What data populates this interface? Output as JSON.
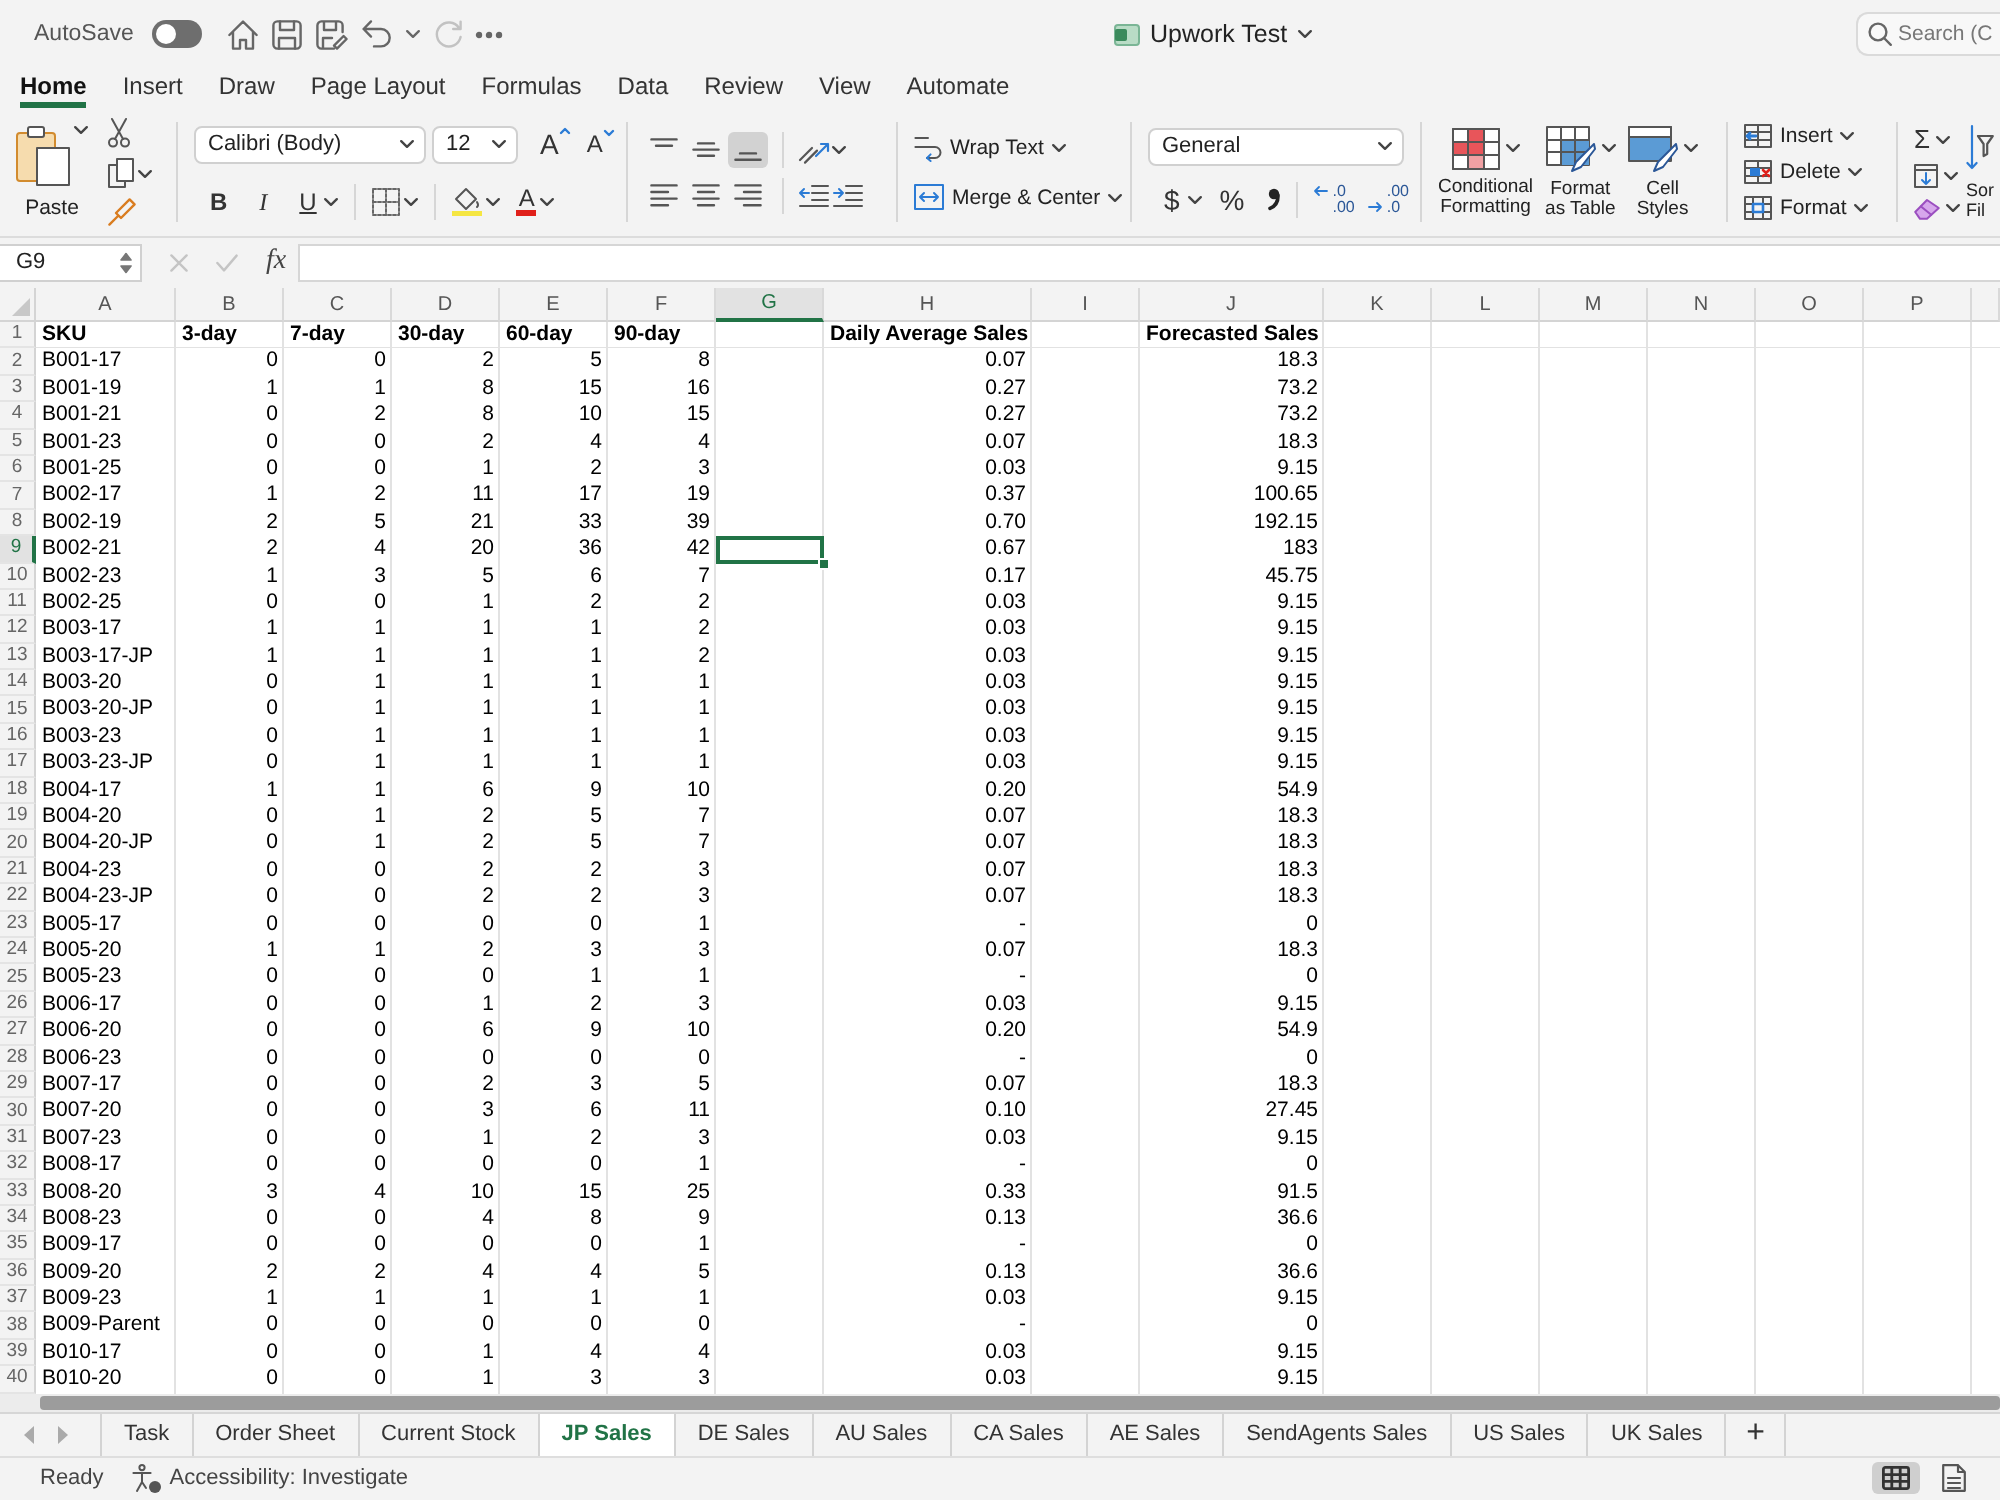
{
  "title_bar": {
    "autosave": {
      "label": "AutoSave",
      "on": false
    },
    "quick_access": [
      {
        "kind": "home",
        "disabled": false
      },
      {
        "kind": "save",
        "disabled": false
      },
      {
        "kind": "save_as",
        "disabled": false
      },
      {
        "kind": "undo",
        "disabled": false
      },
      {
        "kind": "redo",
        "disabled": true
      },
      {
        "kind": "more",
        "disabled": false
      }
    ],
    "document_title": "Upwork Test",
    "search": {
      "placeholder": "Search (C"
    }
  },
  "ribbon_tabs": [
    {
      "label": "Home",
      "selected": true
    },
    {
      "label": "Insert",
      "selected": false
    },
    {
      "label": "Draw",
      "selected": false
    },
    {
      "label": "Page Layout",
      "selected": false
    },
    {
      "label": "Formulas",
      "selected": false
    },
    {
      "label": "Data",
      "selected": false
    },
    {
      "label": "Review",
      "selected": false
    },
    {
      "label": "View",
      "selected": false
    },
    {
      "label": "Automate",
      "selected": false
    }
  ],
  "ribbon": {
    "clipboard": {
      "paste_label": "Paste"
    },
    "font": {
      "name": "Calibri (Body)",
      "size": "12",
      "grow_label": "A",
      "shrink_label": "A",
      "bold_label": "B",
      "italic_label": "I",
      "underline_label": "U",
      "font_color_label": "A"
    },
    "alignment": {
      "vertical": [
        {
          "kind": "top",
          "selected": false
        },
        {
          "kind": "middle",
          "selected": false
        },
        {
          "kind": "bottom",
          "selected": true
        }
      ],
      "horizontal": [
        {
          "kind": "left",
          "selected": false
        },
        {
          "kind": "center",
          "selected": false
        },
        {
          "kind": "right",
          "selected": false
        }
      ],
      "wrap_text_label": "Wrap Text",
      "merge_label": "Merge & Center"
    },
    "number": {
      "format": "General",
      "currency_label": "$",
      "percent_label": "%",
      "decimals": [
        {
          "kind": "increase",
          "lines": [
            ".0",
            ".00"
          ]
        },
        {
          "kind": "decrease",
          "lines": [
            ".00",
            ".0"
          ]
        }
      ]
    },
    "styles": [
      {
        "kind": "conditional",
        "label_lines": [
          "Conditional",
          "Formatting"
        ]
      },
      {
        "kind": "table",
        "label_lines": [
          "Format",
          "as Table"
        ]
      },
      {
        "kind": "cell",
        "label_lines": [
          "Cell",
          "Styles"
        ]
      }
    ],
    "cells": [
      {
        "kind": "insert",
        "label": "Insert"
      },
      {
        "kind": "delete",
        "label": "Delete"
      },
      {
        "kind": "format",
        "label": "Format"
      }
    ],
    "editing": {
      "autosum_label": "Σ",
      "sort_label_lines": [
        "Sor",
        "Fil"
      ]
    }
  },
  "formula_bar": {
    "name_box": "G9",
    "cancel_disabled": true,
    "enter_disabled": true,
    "function_label": "fx"
  },
  "sheet": {
    "columns": [
      {
        "label": "A",
        "selected": false
      },
      {
        "label": "B",
        "selected": false
      },
      {
        "label": "C",
        "selected": false
      },
      {
        "label": "D",
        "selected": false
      },
      {
        "label": "E",
        "selected": false
      },
      {
        "label": "F",
        "selected": false
      },
      {
        "label": "G",
        "selected": true
      },
      {
        "label": "H",
        "selected": false
      },
      {
        "label": "I",
        "selected": false
      },
      {
        "label": "J",
        "selected": false
      },
      {
        "label": "K",
        "selected": false
      },
      {
        "label": "L",
        "selected": false
      },
      {
        "label": "M",
        "selected": false
      },
      {
        "label": "N",
        "selected": false
      },
      {
        "label": "O",
        "selected": false
      },
      {
        "label": "P",
        "selected": false
      }
    ],
    "header_row": {
      "number": "1",
      "selected": false,
      "sku": "SKU",
      "3_day": "3-day",
      "7_day": "7-day",
      "30_day": "30-day",
      "60_day": "60-day",
      "90_day": "90-day",
      "daily_average_sales": "Daily Average Sales",
      "forecasted_sales": "Forecasted Sales"
    },
    "rows": [
      {
        "number": "2",
        "selected": false,
        "sku": "B001-17",
        "3_day": "0",
        "7_day": "0",
        "30_day": "2",
        "60_day": "5",
        "90_day": "8",
        "daily_average_sales": "0.07",
        "forecasted_sales": "18.3"
      },
      {
        "number": "3",
        "selected": false,
        "sku": "B001-19",
        "3_day": "1",
        "7_day": "1",
        "30_day": "8",
        "60_day": "15",
        "90_day": "16",
        "daily_average_sales": "0.27",
        "forecasted_sales": "73.2"
      },
      {
        "number": "4",
        "selected": false,
        "sku": "B001-21",
        "3_day": "0",
        "7_day": "2",
        "30_day": "8",
        "60_day": "10",
        "90_day": "15",
        "daily_average_sales": "0.27",
        "forecasted_sales": "73.2"
      },
      {
        "number": "5",
        "selected": false,
        "sku": "B001-23",
        "3_day": "0",
        "7_day": "0",
        "30_day": "2",
        "60_day": "4",
        "90_day": "4",
        "daily_average_sales": "0.07",
        "forecasted_sales": "18.3"
      },
      {
        "number": "6",
        "selected": false,
        "sku": "B001-25",
        "3_day": "0",
        "7_day": "0",
        "30_day": "1",
        "60_day": "2",
        "90_day": "3",
        "daily_average_sales": "0.03",
        "forecasted_sales": "9.15"
      },
      {
        "number": "7",
        "selected": false,
        "sku": "B002-17",
        "3_day": "1",
        "7_day": "2",
        "30_day": "11",
        "60_day": "17",
        "90_day": "19",
        "daily_average_sales": "0.37",
        "forecasted_sales": "100.65"
      },
      {
        "number": "8",
        "selected": false,
        "sku": "B002-19",
        "3_day": "2",
        "7_day": "5",
        "30_day": "21",
        "60_day": "33",
        "90_day": "39",
        "daily_average_sales": "0.70",
        "forecasted_sales": "192.15"
      },
      {
        "number": "9",
        "selected": true,
        "sku": "B002-21",
        "3_day": "2",
        "7_day": "4",
        "30_day": "20",
        "60_day": "36",
        "90_day": "42",
        "daily_average_sales": "0.67",
        "forecasted_sales": "183"
      },
      {
        "number": "10",
        "selected": false,
        "sku": "B002-23",
        "3_day": "1",
        "7_day": "3",
        "30_day": "5",
        "60_day": "6",
        "90_day": "7",
        "daily_average_sales": "0.17",
        "forecasted_sales": "45.75"
      },
      {
        "number": "11",
        "selected": false,
        "sku": "B002-25",
        "3_day": "0",
        "7_day": "0",
        "30_day": "1",
        "60_day": "2",
        "90_day": "2",
        "daily_average_sales": "0.03",
        "forecasted_sales": "9.15"
      },
      {
        "number": "12",
        "selected": false,
        "sku": "B003-17",
        "3_day": "1",
        "7_day": "1",
        "30_day": "1",
        "60_day": "1",
        "90_day": "2",
        "daily_average_sales": "0.03",
        "forecasted_sales": "9.15"
      },
      {
        "number": "13",
        "selected": false,
        "sku": "B003-17-JP",
        "3_day": "1",
        "7_day": "1",
        "30_day": "1",
        "60_day": "1",
        "90_day": "2",
        "daily_average_sales": "0.03",
        "forecasted_sales": "9.15"
      },
      {
        "number": "14",
        "selected": false,
        "sku": "B003-20",
        "3_day": "0",
        "7_day": "1",
        "30_day": "1",
        "60_day": "1",
        "90_day": "1",
        "daily_average_sales": "0.03",
        "forecasted_sales": "9.15"
      },
      {
        "number": "15",
        "selected": false,
        "sku": "B003-20-JP",
        "3_day": "0",
        "7_day": "1",
        "30_day": "1",
        "60_day": "1",
        "90_day": "1",
        "daily_average_sales": "0.03",
        "forecasted_sales": "9.15"
      },
      {
        "number": "16",
        "selected": false,
        "sku": "B003-23",
        "3_day": "0",
        "7_day": "1",
        "30_day": "1",
        "60_day": "1",
        "90_day": "1",
        "daily_average_sales": "0.03",
        "forecasted_sales": "9.15"
      },
      {
        "number": "17",
        "selected": false,
        "sku": "B003-23-JP",
        "3_day": "0",
        "7_day": "1",
        "30_day": "1",
        "60_day": "1",
        "90_day": "1",
        "daily_average_sales": "0.03",
        "forecasted_sales": "9.15"
      },
      {
        "number": "18",
        "selected": false,
        "sku": "B004-17",
        "3_day": "1",
        "7_day": "1",
        "30_day": "6",
        "60_day": "9",
        "90_day": "10",
        "daily_average_sales": "0.20",
        "forecasted_sales": "54.9"
      },
      {
        "number": "19",
        "selected": false,
        "sku": "B004-20",
        "3_day": "0",
        "7_day": "1",
        "30_day": "2",
        "60_day": "5",
        "90_day": "7",
        "daily_average_sales": "0.07",
        "forecasted_sales": "18.3"
      },
      {
        "number": "20",
        "selected": false,
        "sku": "B004-20-JP",
        "3_day": "0",
        "7_day": "1",
        "30_day": "2",
        "60_day": "5",
        "90_day": "7",
        "daily_average_sales": "0.07",
        "forecasted_sales": "18.3"
      },
      {
        "number": "21",
        "selected": false,
        "sku": "B004-23",
        "3_day": "0",
        "7_day": "0",
        "30_day": "2",
        "60_day": "2",
        "90_day": "3",
        "daily_average_sales": "0.07",
        "forecasted_sales": "18.3"
      },
      {
        "number": "22",
        "selected": false,
        "sku": "B004-23-JP",
        "3_day": "0",
        "7_day": "0",
        "30_day": "2",
        "60_day": "2",
        "90_day": "3",
        "daily_average_sales": "0.07",
        "forecasted_sales": "18.3"
      },
      {
        "number": "23",
        "selected": false,
        "sku": "B005-17",
        "3_day": "0",
        "7_day": "0",
        "30_day": "0",
        "60_day": "0",
        "90_day": "1",
        "daily_average_sales": "-",
        "forecasted_sales": "0"
      },
      {
        "number": "24",
        "selected": false,
        "sku": "B005-20",
        "3_day": "1",
        "7_day": "1",
        "30_day": "2",
        "60_day": "3",
        "90_day": "3",
        "daily_average_sales": "0.07",
        "forecasted_sales": "18.3"
      },
      {
        "number": "25",
        "selected": false,
        "sku": "B005-23",
        "3_day": "0",
        "7_day": "0",
        "30_day": "0",
        "60_day": "1",
        "90_day": "1",
        "daily_average_sales": "-",
        "forecasted_sales": "0"
      },
      {
        "number": "26",
        "selected": false,
        "sku": "B006-17",
        "3_day": "0",
        "7_day": "0",
        "30_day": "1",
        "60_day": "2",
        "90_day": "3",
        "daily_average_sales": "0.03",
        "forecasted_sales": "9.15"
      },
      {
        "number": "27",
        "selected": false,
        "sku": "B006-20",
        "3_day": "0",
        "7_day": "0",
        "30_day": "6",
        "60_day": "9",
        "90_day": "10",
        "daily_average_sales": "0.20",
        "forecasted_sales": "54.9"
      },
      {
        "number": "28",
        "selected": false,
        "sku": "B006-23",
        "3_day": "0",
        "7_day": "0",
        "30_day": "0",
        "60_day": "0",
        "90_day": "0",
        "daily_average_sales": "-",
        "forecasted_sales": "0"
      },
      {
        "number": "29",
        "selected": false,
        "sku": "B007-17",
        "3_day": "0",
        "7_day": "0",
        "30_day": "2",
        "60_day": "3",
        "90_day": "5",
        "daily_average_sales": "0.07",
        "forecasted_sales": "18.3"
      },
      {
        "number": "30",
        "selected": false,
        "sku": "B007-20",
        "3_day": "0",
        "7_day": "0",
        "30_day": "3",
        "60_day": "6",
        "90_day": "11",
        "daily_average_sales": "0.10",
        "forecasted_sales": "27.45"
      },
      {
        "number": "31",
        "selected": false,
        "sku": "B007-23",
        "3_day": "0",
        "7_day": "0",
        "30_day": "1",
        "60_day": "2",
        "90_day": "3",
        "daily_average_sales": "0.03",
        "forecasted_sales": "9.15"
      },
      {
        "number": "32",
        "selected": false,
        "sku": "B008-17",
        "3_day": "0",
        "7_day": "0",
        "30_day": "0",
        "60_day": "0",
        "90_day": "1",
        "daily_average_sales": "-",
        "forecasted_sales": "0"
      },
      {
        "number": "33",
        "selected": false,
        "sku": "B008-20",
        "3_day": "3",
        "7_day": "4",
        "30_day": "10",
        "60_day": "15",
        "90_day": "25",
        "daily_average_sales": "0.33",
        "forecasted_sales": "91.5"
      },
      {
        "number": "34",
        "selected": false,
        "sku": "B008-23",
        "3_day": "0",
        "7_day": "0",
        "30_day": "4",
        "60_day": "8",
        "90_day": "9",
        "daily_average_sales": "0.13",
        "forecasted_sales": "36.6"
      },
      {
        "number": "35",
        "selected": false,
        "sku": "B009-17",
        "3_day": "0",
        "7_day": "0",
        "30_day": "0",
        "60_day": "0",
        "90_day": "1",
        "daily_average_sales": "-",
        "forecasted_sales": "0"
      },
      {
        "number": "36",
        "selected": false,
        "sku": "B009-20",
        "3_day": "2",
        "7_day": "2",
        "30_day": "4",
        "60_day": "4",
        "90_day": "5",
        "daily_average_sales": "0.13",
        "forecasted_sales": "36.6"
      },
      {
        "number": "37",
        "selected": false,
        "sku": "B009-23",
        "3_day": "1",
        "7_day": "1",
        "30_day": "1",
        "60_day": "1",
        "90_day": "1",
        "daily_average_sales": "0.03",
        "forecasted_sales": "9.15"
      },
      {
        "number": "38",
        "selected": false,
        "sku": "B009-Parent",
        "3_day": "0",
        "7_day": "0",
        "30_day": "0",
        "60_day": "0",
        "90_day": "0",
        "daily_average_sales": "-",
        "forecasted_sales": "0"
      },
      {
        "number": "39",
        "selected": false,
        "sku": "B010-17",
        "3_day": "0",
        "7_day": "0",
        "30_day": "1",
        "60_day": "4",
        "90_day": "4",
        "daily_average_sales": "0.03",
        "forecasted_sales": "9.15"
      },
      {
        "number": "40",
        "selected": false,
        "sku": "B010-20",
        "3_day": "0",
        "7_day": "0",
        "30_day": "1",
        "60_day": "3",
        "90_day": "3",
        "daily_average_sales": "0.03",
        "forecasted_sales": "9.15"
      }
    ]
  },
  "sheet_tabs": [
    {
      "label": "Task",
      "selected": false
    },
    {
      "label": "Order Sheet",
      "selected": false
    },
    {
      "label": "Current Stock",
      "selected": false
    },
    {
      "label": "JP Sales",
      "selected": true
    },
    {
      "label": "DE Sales",
      "selected": false
    },
    {
      "label": "AU Sales",
      "selected": false
    },
    {
      "label": "CA Sales",
      "selected": false
    },
    {
      "label": "AE Sales",
      "selected": false
    },
    {
      "label": "SendAgents Sales",
      "selected": false
    },
    {
      "label": "US Sales",
      "selected": false
    },
    {
      "label": "UK Sales",
      "selected": false
    }
  ],
  "add_sheet_label": "+",
  "status_bar": {
    "status": "Ready",
    "accessibility": "Accessibility: Investigate",
    "views": [
      {
        "kind": "normal",
        "selected": true
      },
      {
        "kind": "page_layout",
        "selected": false
      }
    ]
  }
}
